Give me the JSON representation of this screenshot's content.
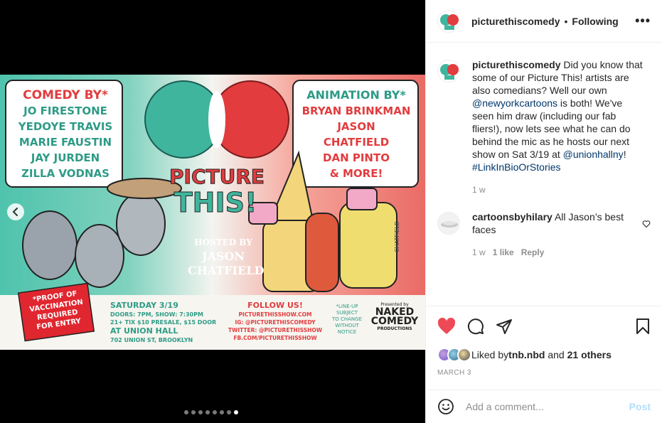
{
  "post": {
    "username": "picturethiscomedy",
    "separator": "•",
    "follow_label": "Following",
    "more_label": "•••",
    "caption": {
      "username": "picturethiscomedy",
      "text_1": " Did you know that some of our Picture This! artists are also comedians? Well our own ",
      "mention_1": "@newyorkcartoons",
      "text_2": " is both! We've seen him draw (including our fab fliers!), now lets see what he can do behind the mic as he hosts our next show on Sat 3/19 at ",
      "mention_2": "@unionhallny",
      "text_3": "! ",
      "hashtag": "#LinkInBioOrStories",
      "age": "1 w"
    },
    "comment": {
      "username": "cartoonsbyhilary",
      "text": " All Jason’s best faces",
      "age": "1 w",
      "likes": "1 like",
      "reply_label": "Reply"
    },
    "liked_by_prefix": "Liked by ",
    "liked_by_user": "tnb.nbd",
    "liked_by_mid": " and ",
    "liked_by_others": "21 others",
    "date": "MARCH 3",
    "add_comment_placeholder": "Add a comment...",
    "post_button": "Post"
  },
  "poster": {
    "comedy_heading": "COMEDY BY*",
    "comedians": [
      "JO FIRESTONE",
      "YEDOYE TRAVIS",
      "MARIE FAUSTIN",
      "JAY JURDEN",
      "ZILLA VODNAS"
    ],
    "animation_heading": "ANIMATION BY*",
    "animators": [
      "BRYAN BRINKMAN",
      "JASON",
      "CHATFIELD",
      "DAN PINTO",
      "& MORE!"
    ],
    "title_1": "PICTURE",
    "title_2": "THIS!",
    "hosted_by": "HOSTED BY",
    "host_1": "JASON",
    "host_2": "CHATFIELD",
    "vax": [
      "*PROOF OF",
      "VACCINATION",
      "REQUIRED",
      "FOR ENTRY"
    ],
    "date_line": "SATURDAY 3/19",
    "doors": "DOORS: 7PM, SHOW: 7:30PM",
    "tix": "21+ TIX $10 PRESALE, $15 DOOR",
    "venue": "AT UNION HALL",
    "address": "702 UNION ST, BROOKLYN",
    "follow_us": "FOLLOW US!",
    "site": "PICTURETHISSHOW.COM",
    "ig": "IG: @PICTURETHISCOMEDY",
    "twitter": "TWITTER: @PICTURETHISSHOW",
    "fb": "FB.COM/PICTURETHISSHOW",
    "lineup_note": [
      "*LINE-UP",
      "SUBJECT",
      "TO CHANGE",
      "WITHOUT",
      "NOTICE"
    ],
    "presented_by": "Presented by",
    "sponsor_1": "NAKED",
    "sponsor_2": "COMEDY",
    "sponsor_3": "PRODUCTIONS",
    "signature": "CHATFIELD"
  },
  "carousel": {
    "total": 8,
    "active_index": 7
  },
  "colors": {
    "teal": "#3cb6a0",
    "red": "#e53b3b",
    "link": "#00376b",
    "like_red": "#ed4956",
    "muted": "#8e8e8e",
    "post_disabled": "#b2dffc"
  },
  "icons": [
    "chevron-left-icon",
    "heart-icon",
    "comment-icon",
    "share-icon",
    "bookmark-icon",
    "emoji-icon",
    "more-icon"
  ]
}
